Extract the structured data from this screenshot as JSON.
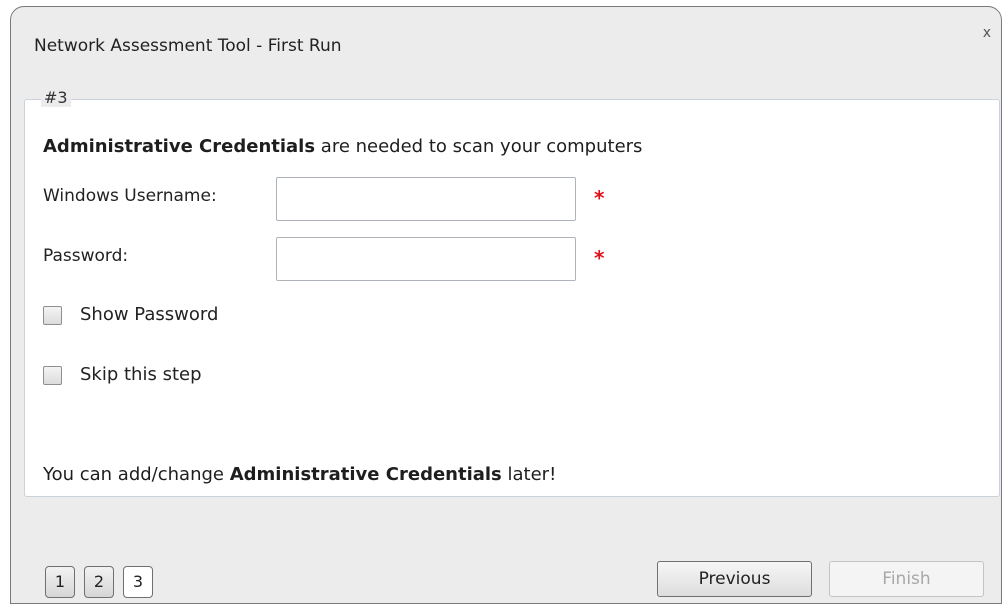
{
  "window": {
    "title": "Network Assessment Tool - First Run",
    "close_label": "x"
  },
  "step_group": {
    "legend": "#3",
    "intro_bold": "Administrative Credentials",
    "intro_rest": " are needed to scan your computers",
    "username_label": "Windows Username:",
    "username_value": "",
    "password_label": "Password:",
    "password_value": "",
    "required_marker": "*",
    "show_password_label": "Show Password",
    "show_password_checked": false,
    "skip_step_label": "Skip this step",
    "skip_step_checked": false,
    "footnote_pre": "You can add/change ",
    "footnote_bold": "Administrative Credentials",
    "footnote_post": " later!"
  },
  "steps": [
    "1",
    "2",
    "3"
  ],
  "current_step": "3",
  "buttons": {
    "previous": "Previous",
    "finish": "Finish",
    "finish_enabled": false
  }
}
